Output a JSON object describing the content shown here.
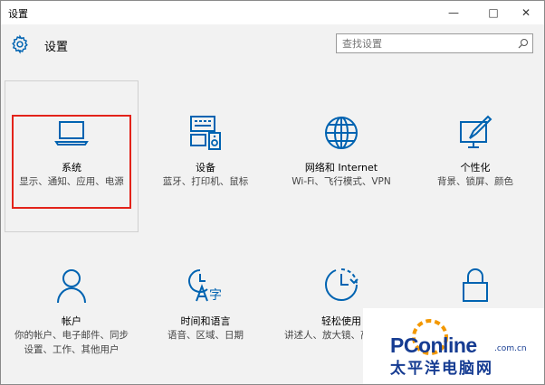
{
  "window": {
    "title": "设置",
    "controls": {
      "minimize": "—",
      "maximize": "□",
      "close": "✕"
    }
  },
  "header": {
    "title": "设置",
    "search_placeholder": "查找设置",
    "icon": "gear-icon"
  },
  "colors": {
    "accent": "#0063b1",
    "selection": "#e3231a",
    "background": "#f2f2f2"
  },
  "tiles": [
    {
      "name": "系统",
      "desc": "显示、通知、应用、电源",
      "icon": "laptop-icon"
    },
    {
      "name": "设备",
      "desc": "蓝牙、打印机、鼠标",
      "icon": "devices-icon"
    },
    {
      "name": "网络和 Internet",
      "desc": "Wi-Fi、飞行模式、VPN",
      "icon": "globe-icon"
    },
    {
      "name": "个性化",
      "desc": "背景、锁屏、颜色",
      "icon": "personalize-icon"
    },
    {
      "name": "帐户",
      "desc": "你的帐户、电子邮件、同步设置、工作、其他用户",
      "icon": "person-icon"
    },
    {
      "name": "时间和语言",
      "desc": "语音、区域、日期",
      "icon": "time-language-icon"
    },
    {
      "name": "轻松使用",
      "desc": "讲述人、放大镜、高对比度",
      "icon": "ease-of-access-icon"
    },
    {
      "name": "",
      "desc": "",
      "icon": "lock-icon"
    }
  ],
  "watermark": {
    "logo": "PConline",
    "domain": ".com.cn",
    "cn": "太平洋电脑网"
  }
}
